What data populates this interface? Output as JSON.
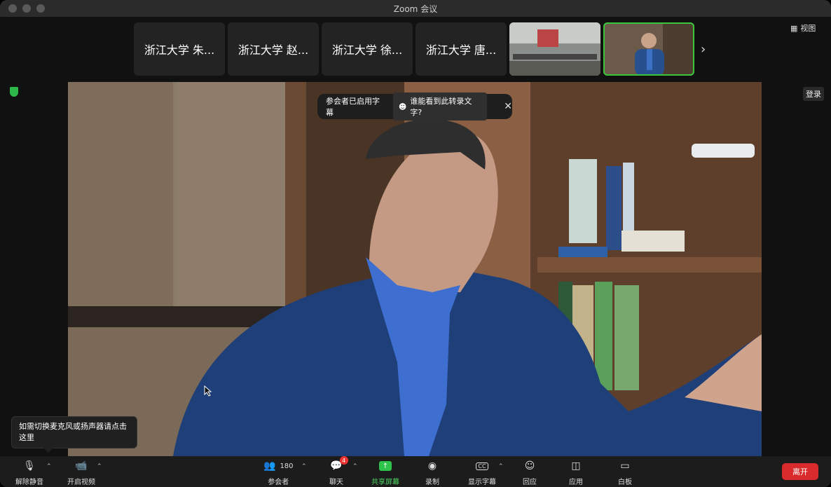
{
  "window": {
    "title": "Zoom 会议"
  },
  "thumbnails": [
    {
      "label": "浙江大学 朱..."
    },
    {
      "label": "浙江大学 赵..."
    },
    {
      "label": "浙江大学 徐..."
    },
    {
      "label": "浙江大学 唐..."
    }
  ],
  "view_button": {
    "label": "视图"
  },
  "login_button": {
    "label": "登录"
  },
  "caption_banner": {
    "status": "参会者已启用字幕",
    "who_can_see": "谁能看到此转录文字?"
  },
  "tooltip": {
    "text": "如需切换麦克风或扬声器请点击这里"
  },
  "toolbar": {
    "unmute": "解除静音",
    "start_video": "开启视频",
    "participants": "参会者",
    "participants_count": "180",
    "chat": "聊天",
    "chat_badge": "4",
    "share_screen": "共享屏幕",
    "record": "录制",
    "show_captions": "显示字幕",
    "reactions": "回应",
    "apps": "应用",
    "whiteboard": "白板",
    "leave": "离开"
  },
  "colors": {
    "share_green": "#2ec44b",
    "leave_red": "#d92b2b",
    "active_speaker_border": "#39c739"
  }
}
